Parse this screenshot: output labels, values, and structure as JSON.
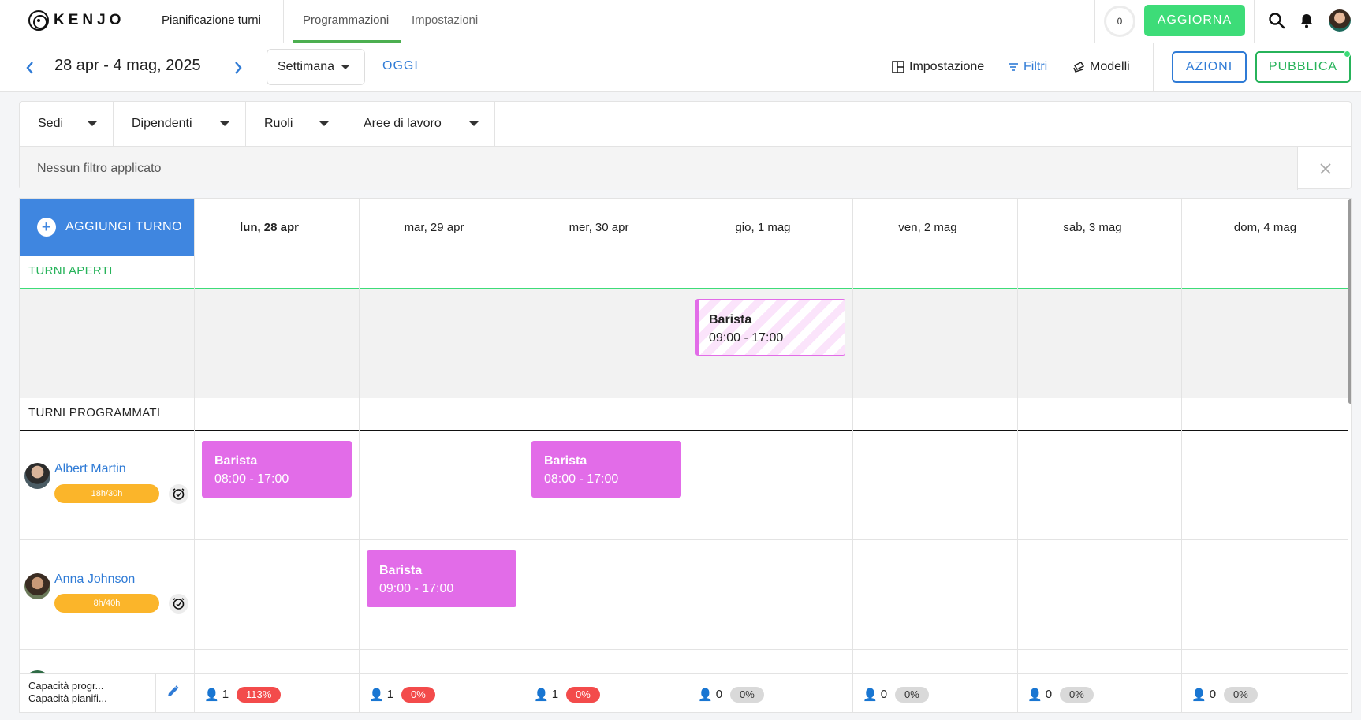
{
  "topbar": {
    "logo_text": "KENJO",
    "app_title": "Pianificazione turni",
    "tabs": [
      {
        "label": "Programmazioni",
        "active": true
      },
      {
        "label": "Impostazioni",
        "active": false
      }
    ],
    "counter": "0",
    "update_button": "AGGIORNA",
    "icons": [
      "search-icon",
      "bell-icon",
      "user-avatar"
    ],
    "accent_color": "#3ddc78"
  },
  "subbar": {
    "date_range": "28 apr - 4 mag, 2025",
    "view_select": "Settimana",
    "today": "OGGI",
    "layout_label": "Impostazione",
    "filters_label": "Filtri",
    "templates_label": "Modelli",
    "actions_button": "AZIONI",
    "publish_button": "PUBBLICA"
  },
  "filters": {
    "dropdowns": [
      "Sedi",
      "Dipendenti",
      "Ruoli",
      "Aree di lavoro"
    ],
    "status": "Nessun filtro applicato"
  },
  "grid": {
    "add_shift": "AGGIUNGI TURNO",
    "days": [
      "lun, 28 apr",
      "mar, 29 apr",
      "mer, 30 apr",
      "gio, 1 mag",
      "ven, 2 mag",
      "sab, 3 mag",
      "dom, 4 mag"
    ],
    "open_shifts_label": "TURNI APERTI",
    "scheduled_label": "TURNI PROGRAMMATI",
    "open_shifts": [
      {
        "day_index": 3,
        "role": "Barista",
        "time": "09:00 - 17:00"
      }
    ],
    "employees": [
      {
        "name": "Albert Martin",
        "hours": "18h/30h",
        "shifts": [
          {
            "day_index": 0,
            "role": "Barista",
            "time": "08:00 - 17:00"
          },
          {
            "day_index": 2,
            "role": "Barista",
            "time": "08:00 - 17:00"
          }
        ]
      },
      {
        "name": "Anna Johnson",
        "hours": "8h/40h",
        "shifts": [
          {
            "day_index": 1,
            "role": "Barista",
            "time": "09:00 - 17:00"
          }
        ]
      }
    ],
    "shift_color": "#e26ce8"
  },
  "footer": {
    "capacity_labels": [
      "Capacità progr...",
      "Capacità pianifi..."
    ],
    "days": [
      {
        "count": "1",
        "pct": "113%",
        "status": "red"
      },
      {
        "count": "1",
        "pct": "0%",
        "status": "red"
      },
      {
        "count": "1",
        "pct": "0%",
        "status": "red"
      },
      {
        "count": "0",
        "pct": "0%",
        "status": "grey"
      },
      {
        "count": "0",
        "pct": "0%",
        "status": "grey"
      },
      {
        "count": "0",
        "pct": "0%",
        "status": "grey"
      },
      {
        "count": "0",
        "pct": "0%",
        "status": "grey"
      }
    ]
  }
}
